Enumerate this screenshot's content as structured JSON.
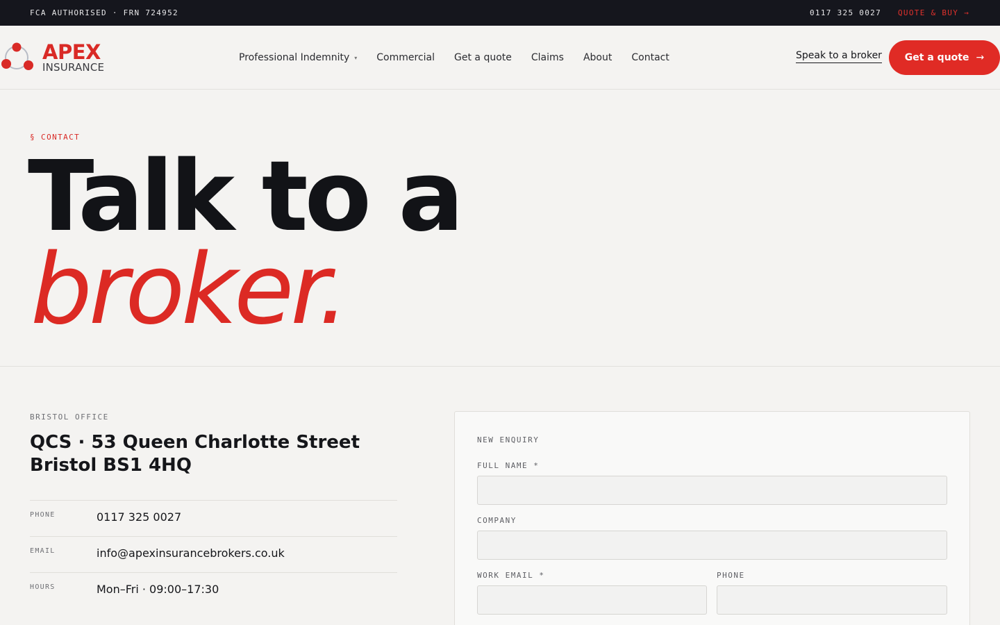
{
  "topbar": {
    "authorisation": "FCA AUTHORISED · FRN 724952",
    "phone": "0117 325 0027",
    "quote_buy": "QUOTE & BUY →"
  },
  "brand": {
    "name_line1": "APEX",
    "name_line2": "INSURANCE",
    "accent_color": "#e02b25",
    "dark_color": "#15161d"
  },
  "nav": {
    "items": [
      {
        "label": "Professional Indemnity",
        "has_dropdown": true
      },
      {
        "label": "Commercial"
      },
      {
        "label": "Get a quote"
      },
      {
        "label": "Claims"
      },
      {
        "label": "About"
      },
      {
        "label": "Contact"
      }
    ],
    "caret": "▾",
    "speak_link": "Speak to a broker",
    "cta_label": "Get a quote",
    "cta_arrow": "→"
  },
  "hero": {
    "eyebrow": "§ CONTACT",
    "title_line1": "Talk to a",
    "title_line2": "broker."
  },
  "office": {
    "label": "BRISTOL OFFICE",
    "address_line1": "QCS · 53 Queen Charlotte Street",
    "address_line2": "Bristol BS1 4HQ",
    "details": [
      {
        "key": "PHONE",
        "value": "0117 325 0027"
      },
      {
        "key": "EMAIL",
        "value": "info@apexinsurancebrokers.co.uk"
      },
      {
        "key": "HOURS",
        "value": "Mon–Fri · 09:00–17:30"
      }
    ]
  },
  "form": {
    "heading": "NEW ENQUIRY",
    "full_name_label": "FULL NAME *",
    "full_name_value": "",
    "company_label": "COMPANY",
    "company_value": "",
    "email_label": "WORK EMAIL *",
    "email_value": "",
    "phone_label": "PHONE",
    "phone_value": ""
  }
}
